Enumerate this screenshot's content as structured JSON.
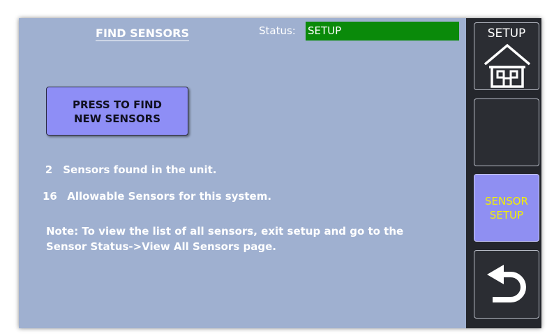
{
  "header": {
    "title": "FIND SENSORS",
    "status_label": "Status:",
    "status_value": "SETUP"
  },
  "main": {
    "find_button_label": "PRESS TO FIND\nNEW SENSORS",
    "found": {
      "count": "2",
      "text": "Sensors found in the unit."
    },
    "allowable": {
      "count": "16",
      "text": "Allowable Sensors for this system."
    },
    "note": "Note: To view the list of all sensors, exit setup and go to the Sensor Status->View All Sensors page."
  },
  "sidebar": {
    "setup_label": "SETUP",
    "setup_icon": "home-icon",
    "sensor_setup_label": "SENSOR\nSETUP",
    "back_icon": "back-arrow-icon"
  },
  "colors": {
    "screen_bg": "#9fb0d0",
    "status_bg": "#0a8a0a",
    "button_bg": "#8e8ef6",
    "sidebar_bg": "#24262c",
    "sensor_setup_text": "#f4f000"
  }
}
